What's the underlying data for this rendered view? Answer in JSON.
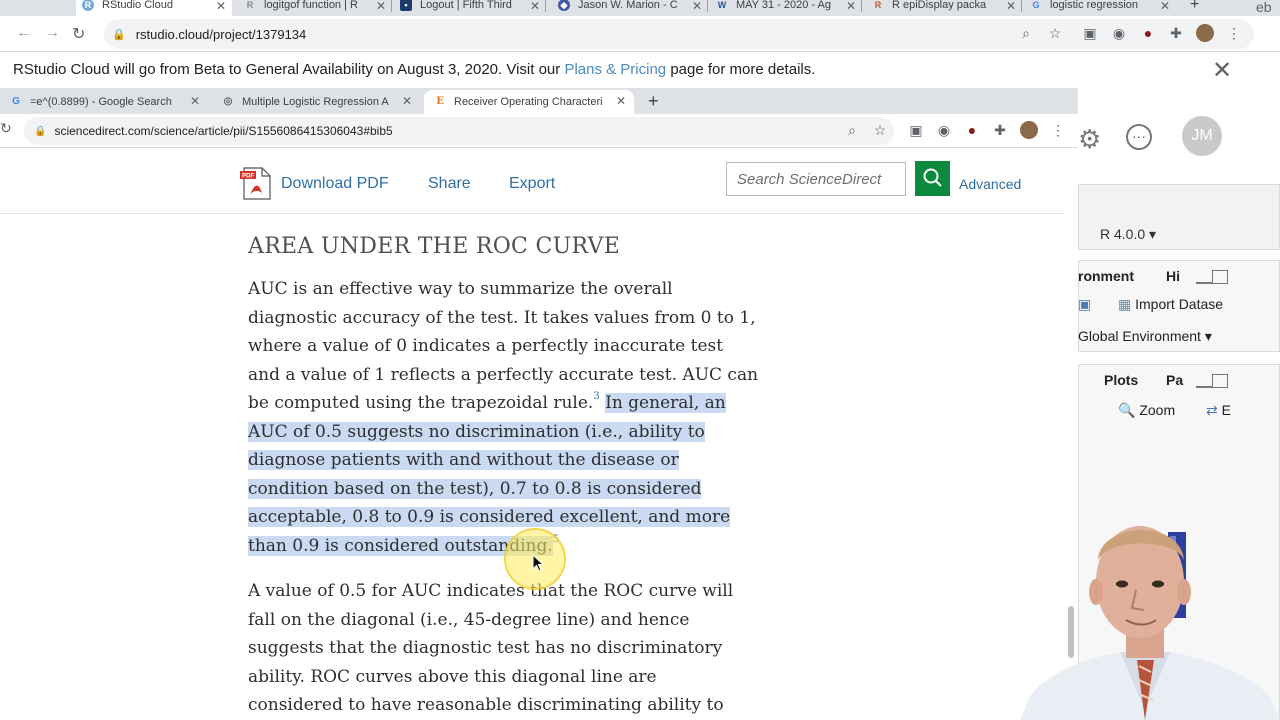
{
  "outer_browser": {
    "tabs": [
      {
        "title": "RStudio Cloud",
        "icon": "rstudio-icon"
      },
      {
        "title": "logitgof function | R",
        "icon": "r-docs-icon"
      },
      {
        "title": "Logout | Fifth Third",
        "icon": "bank-icon"
      },
      {
        "title": "Jason W. Marion - C",
        "icon": "profile-icon"
      },
      {
        "title": "MAY 31 - 2020 - Ag",
        "icon": "word-icon"
      },
      {
        "title": "R epiDisplay packa",
        "icon": "r-docs-icon"
      },
      {
        "title": "logistic regression",
        "icon": "google-icon"
      }
    ],
    "url": "rstudio.cloud/project/1379134",
    "partial_right_label": "eb"
  },
  "banner": {
    "text_before": "RStudio Cloud will go from Beta to General Availability on August 3, 2020. Visit our ",
    "link": "Plans & Pricing",
    "text_after": " page for more details."
  },
  "rstudio": {
    "avatar": "JM",
    "r_version": "R 4.0.0",
    "env_tab": "ronment",
    "history_tab": "Hi",
    "import_label": "Import Datase",
    "global_env": "Global Environment",
    "plots_tab": "Plots",
    "packages_tab": "Pa",
    "zoom_label": "Zoom",
    "export_label": "E"
  },
  "inner_browser": {
    "tabs": [
      {
        "title": "=e^(0.8899) - Google Search",
        "icon": "google-icon"
      },
      {
        "title": "Multiple Logistic Regression A",
        "icon": "globe-icon"
      },
      {
        "title": "Receiver Operating Characteri",
        "icon": "elsevier-icon"
      }
    ],
    "url": "sciencedirect.com/science/article/pii/S1556086415306043#bib5"
  },
  "sciencedirect": {
    "download_pdf": "Download PDF",
    "share": "Share",
    "export": "Export",
    "search_placeholder": "Search ScienceDirect",
    "advanced": "Advanced"
  },
  "article": {
    "heading": "AREA UNDER THE ROC CURVE",
    "para1_lines": [
      "AUC is an effective way to summarize the overall",
      "diagnostic accuracy of the test. It takes values from 0 to 1,",
      "where a value of 0 indicates a perfectly inaccurate test",
      "and a value of 1 reflects a perfectly accurate test. AUC can"
    ],
    "para1_line5_plain": "be computed using the trapezoidal rule.",
    "para1_line5_sup": "3",
    "para1_line5_highlight": "In general, an",
    "para1_highlight_lines": [
      "AUC of 0.5 suggests no discrimination (i.e., ability to",
      "diagnose patients with and without the disease or",
      "condition based on the test), 0.7 to 0.8 is considered",
      "acceptable, 0.8 to 0.9 is considered excellent, and more"
    ],
    "para1_last_highlight": "than 0.9 is considered outstanding.",
    "para1_last_sup": "5",
    "para2_lines": [
      "A value of 0.5 for AUC indicates that the ROC curve will",
      "fall on the diagonal (i.e., 45-degree line) and hence",
      "suggests that the diagnostic test has no discriminatory",
      "ability. ROC curves above this diagonal line are",
      "considered to have reasonable discriminating ability to"
    ]
  },
  "colors": {
    "highlight": "#c9daf2",
    "link": "#2e6fa6",
    "search_button": "#0b8a3e",
    "cursor_halo": "#ffec5a"
  }
}
